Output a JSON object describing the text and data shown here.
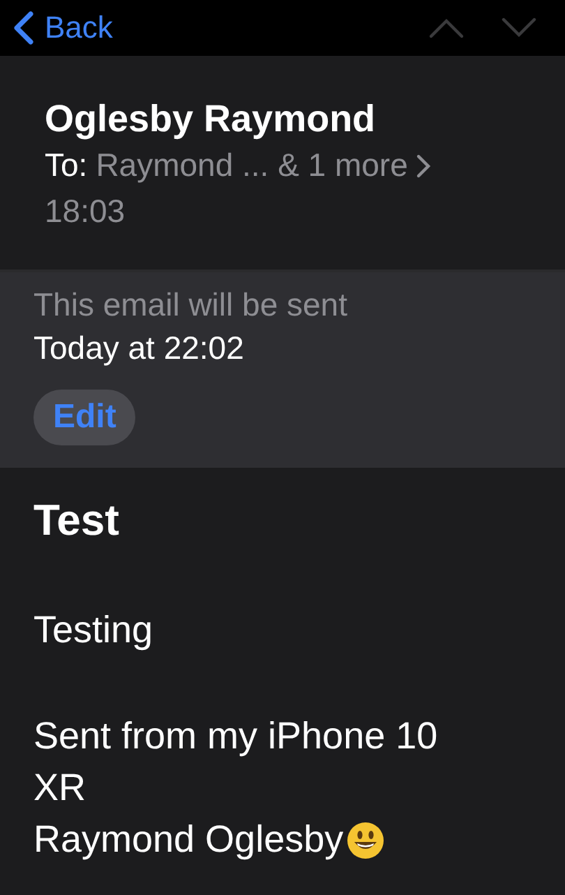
{
  "nav": {
    "back_label": "Back",
    "previous_enabled": false,
    "next_enabled": false
  },
  "header": {
    "sender": "Oglesby Raymond",
    "to_label": "To:",
    "recipients": "Raymond ... & 1 more",
    "time": "18:03"
  },
  "schedule": {
    "note": "This email will be sent",
    "when": "Today at 22:02",
    "edit_label": "Edit"
  },
  "message": {
    "subject": "Test",
    "body": "Testing",
    "signature_lines": [
      "Sent from my iPhone 10",
      "XR",
      "Raymond Oglesby"
    ],
    "signature_emoji": true
  }
}
